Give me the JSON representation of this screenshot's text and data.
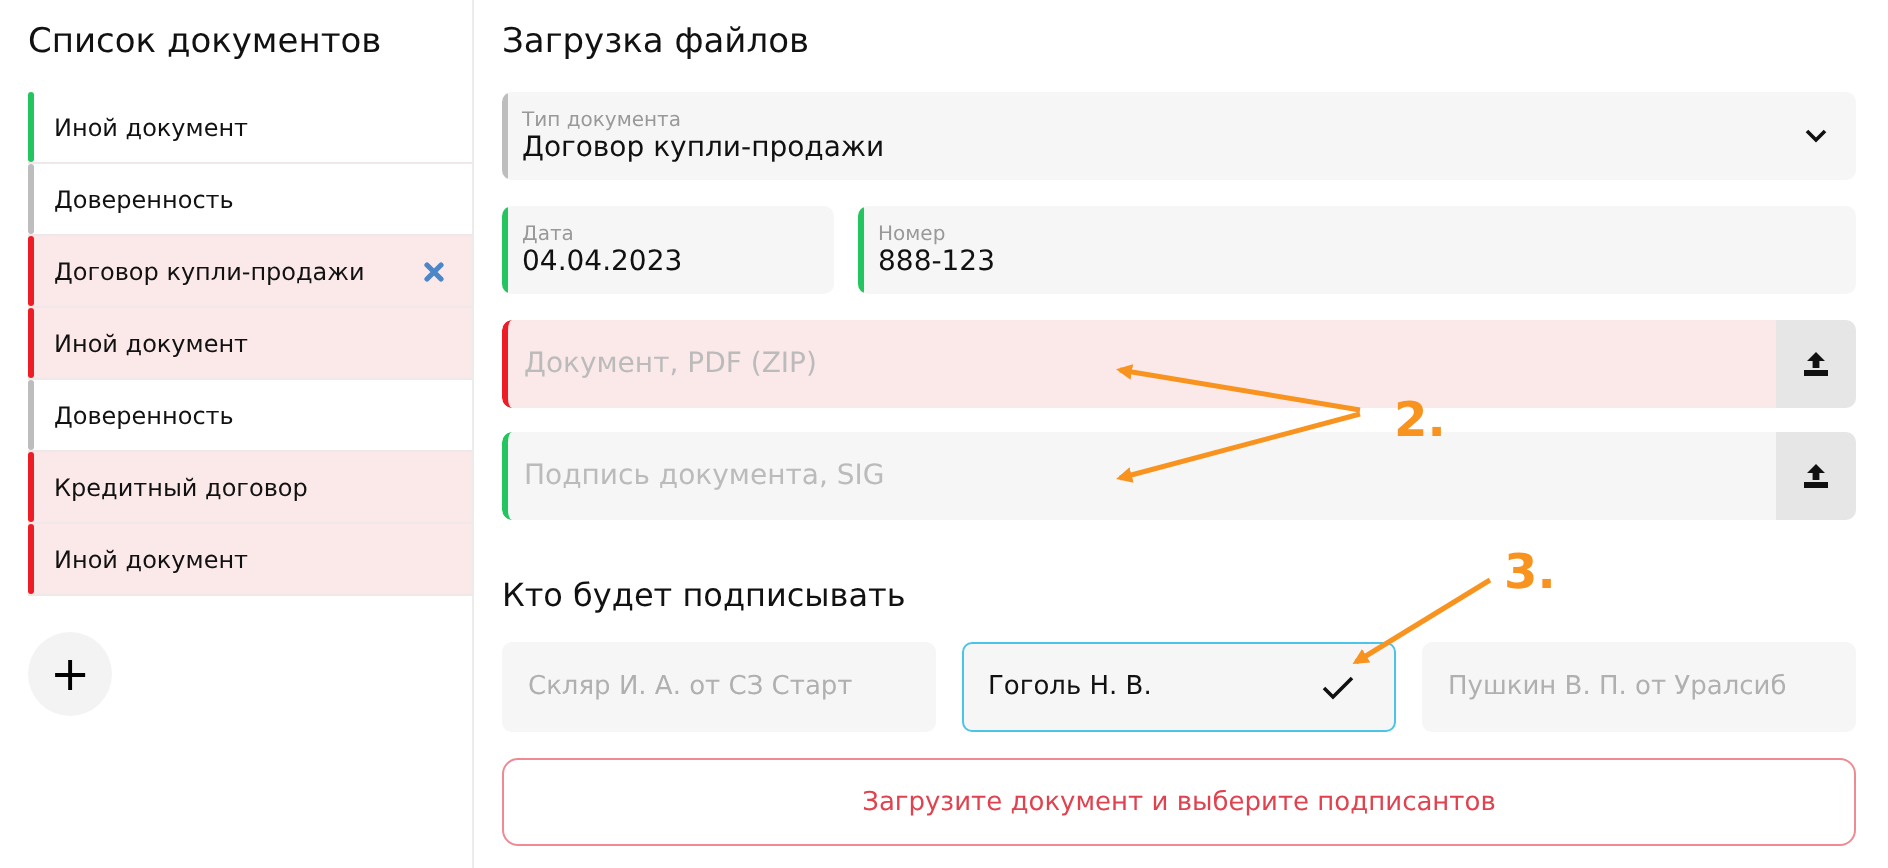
{
  "sidebar": {
    "title": "Список документов",
    "items": [
      {
        "label": "Иной документ",
        "color": "#22c55e",
        "error": false,
        "selected": false
      },
      {
        "label": "Доверенность",
        "color": "#bdbdbd",
        "error": false,
        "selected": false
      },
      {
        "label": "Договор купли-продажи",
        "color": "#ee1c25",
        "error": true,
        "selected": true
      },
      {
        "label": "Иной документ",
        "color": "#ee1c25",
        "error": true,
        "selected": false
      },
      {
        "label": "Доверенность",
        "color": "#bdbdbd",
        "error": false,
        "selected": false
      },
      {
        "label": "Кредитный договор",
        "color": "#ee1c25",
        "error": true,
        "selected": false
      },
      {
        "label": "Иной документ",
        "color": "#ee1c25",
        "error": true,
        "selected": false
      }
    ],
    "add_button": {
      "label": "+"
    }
  },
  "main": {
    "title": "Загрузка файлов",
    "doc_type": {
      "label": "Тип документа",
      "value": "Договор купли-продажи",
      "color": "#bdbdbd"
    },
    "date": {
      "label": "Дата",
      "value": "04.04.2023",
      "color": "#22c55e"
    },
    "number": {
      "label": "Номер",
      "value": "888-123",
      "color": "#22c55e"
    },
    "uploads": [
      {
        "placeholder": "Документ, PDF (ZIP)",
        "color": "#ee1c25",
        "error": true
      },
      {
        "placeholder": "Подпись документа, SIG",
        "color": "#22c55e",
        "error": false
      }
    ],
    "signers_title": "Кто будет подписывать",
    "signers": [
      {
        "label": "Скляр И. А. от СЗ Старт",
        "selected": false
      },
      {
        "label": "Гоголь Н. В.",
        "selected": true
      },
      {
        "label": "Пушкин В. П. от Уралсиб",
        "selected": false
      }
    ],
    "submit": {
      "label": "Загрузите документ и выберите подписантов"
    }
  },
  "annotations": [
    {
      "label": "2."
    },
    {
      "label": "3."
    }
  ]
}
